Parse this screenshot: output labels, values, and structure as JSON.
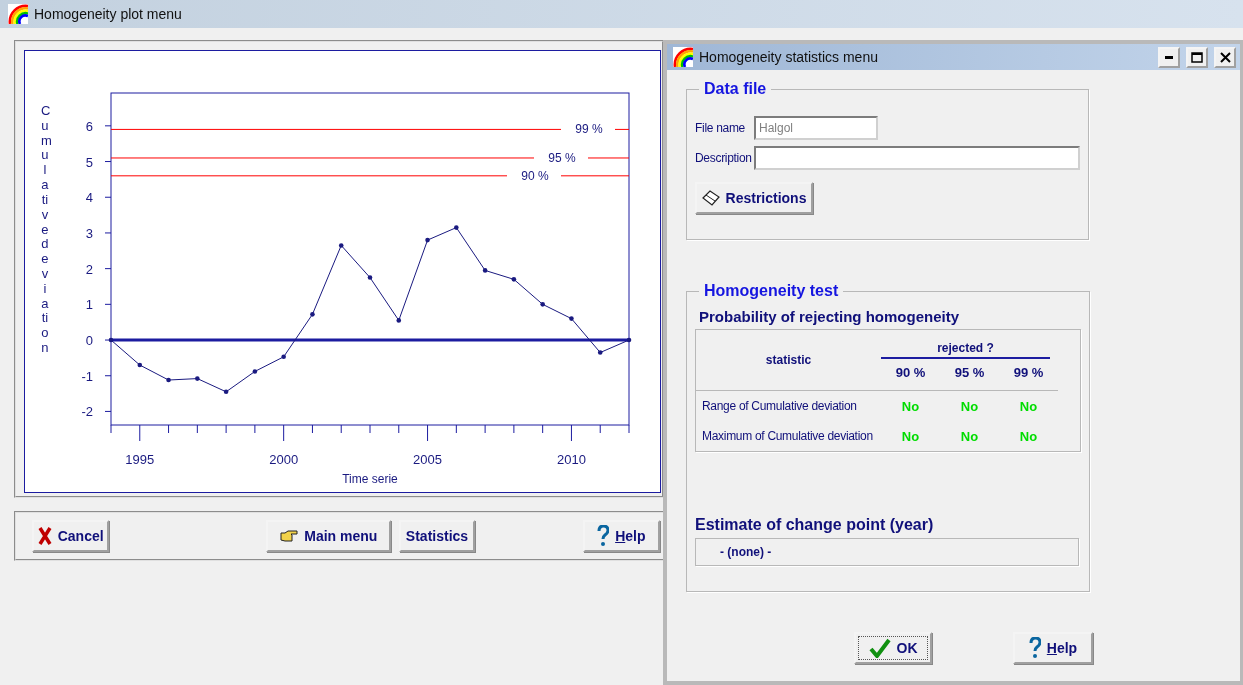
{
  "main_window": {
    "title": "Homogeneity plot menu",
    "chart": {
      "chart_data": {
        "type": "line",
        "xlabel": "Time serie",
        "ylabel": "Cumulative deviation",
        "x": [
          1994,
          1995,
          1996,
          1997,
          1998,
          1999,
          2000,
          2001,
          2002,
          2003,
          2004,
          2005,
          2006,
          2007,
          2008,
          2009,
          2010,
          2011,
          2012
        ],
        "series": [
          {
            "color": "#1a1a80",
            "values": [
              0,
              -0.7,
              -1.12,
              -1.08,
              -1.45,
              -0.88,
              -0.47,
              0.72,
              2.65,
              1.75,
              0.55,
              2.8,
              3.15,
              1.95,
              1.7,
              1.0,
              0.6,
              -0.35,
              0
            ]
          }
        ],
        "xlim": [
          1994,
          2012
        ],
        "ylim": [
          -2.38,
          6.92
        ],
        "xticks": [
          1995,
          2000,
          2005,
          2010
        ],
        "yticks": [
          -2,
          -1,
          0,
          1,
          2,
          3,
          4,
          5,
          6
        ],
        "ref_lines": [
          {
            "axis": "y",
            "value": 5.9,
            "color": "#ff0000"
          },
          {
            "axis": "y",
            "value": 5.1,
            "color": "#ff0000"
          },
          {
            "axis": "y",
            "value": 4.6,
            "color": "#ff0000"
          },
          {
            "axis": "y",
            "value": 0,
            "color": "#1c1ca0"
          }
        ]
      },
      "threshold_labels": [
        "99 %",
        "95 %",
        "90 %"
      ]
    },
    "buttons": [
      {
        "kind": "cancel",
        "label": "Cancel"
      },
      {
        "kind": "main",
        "label": "Main menu"
      },
      {
        "kind": "plain",
        "label": "Statistics"
      },
      {
        "kind": "help",
        "label": "Help"
      }
    ]
  },
  "dialog": {
    "title": "Homogeneity statistics menu",
    "data_file": {
      "title": "Data file",
      "file_name_label": "File name",
      "file_name": "Halgol",
      "description_label": "Description",
      "restrictions_button": "Restrictions"
    },
    "homogeneity_test": {
      "title": "Homogeneity test",
      "subtitle": "Probability of rejecting homogeneity",
      "table": {
        "statistic_header": "statistic",
        "group_header": "rejected ?",
        "levels": [
          "90 %",
          "95 %",
          "99 %"
        ],
        "rows": [
          {
            "name": "Range of Cumulative deviation",
            "results": [
              "No",
              "No",
              "No"
            ]
          },
          {
            "name": "Maximum of Cumulative deviation",
            "results": [
              "No",
              "No",
              "No"
            ]
          }
        ]
      },
      "change_point_title": "Estimate of change point (year)",
      "change_point": "- (none) -"
    },
    "buttons": [
      {
        "kind": "ok",
        "label": "OK"
      },
      {
        "kind": "help",
        "label": "Help"
      }
    ]
  }
}
